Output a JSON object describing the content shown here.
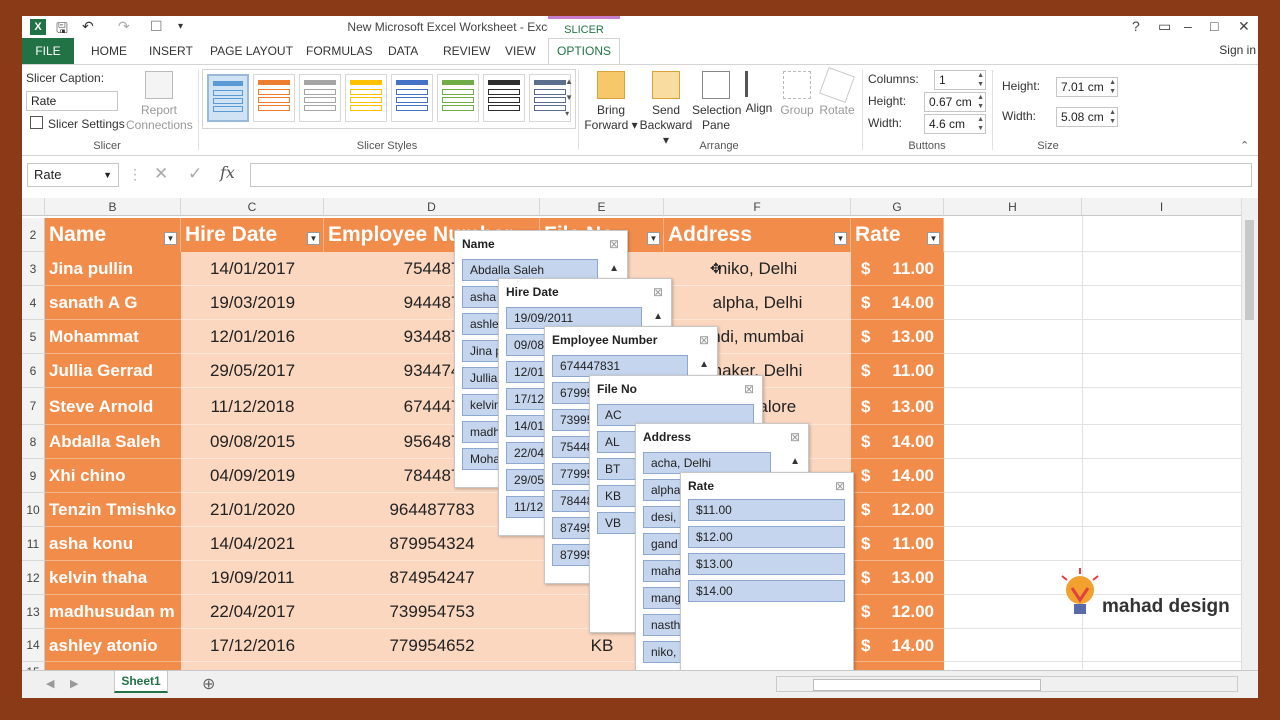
{
  "title_bar": {
    "title": "New Microsoft Excel Worksheet - Excel",
    "contextual_tab_group": "SLICER TOOLS",
    "help": "?",
    "window_controls": [
      "▭",
      "–",
      "□",
      "✕"
    ]
  },
  "ribbon_tabs": [
    "FILE",
    "HOME",
    "INSERT",
    "PAGE LAYOUT",
    "FORMULAS",
    "DATA",
    "REVIEW",
    "VIEW",
    "OPTIONS"
  ],
  "sign_in": "Sign in",
  "ribbon": {
    "slicer_group": {
      "caption_label": "Slicer Caption:",
      "caption_value": "Rate",
      "settings_label": "Slicer Settings",
      "report_connections_line1": "Report",
      "report_connections_line2": "Connections",
      "group_label": "Slicer"
    },
    "styles_group_label": "Slicer Styles",
    "style_colors": [
      "#5b9bd5",
      "#ed7d31",
      "#a5a5a5",
      "#ffc000",
      "#4472c4",
      "#70ad47",
      "#2e2e2e",
      "#5b6e8e"
    ],
    "arrange_group": {
      "bring_forward_1": "Bring",
      "bring_forward_2": "Forward ▾",
      "send_backward_1": "Send",
      "send_backward_2": "Backward ▾",
      "selection_pane_1": "Selection",
      "selection_pane_2": "Pane",
      "align": "Align",
      "group": "Group",
      "rotate": "Rotate",
      "group_label": "Arrange"
    },
    "buttons_group": {
      "columns_label": "Columns:",
      "columns_value": "1",
      "height_label": "Height:",
      "height_value": "0.67 cm",
      "width_label": "Width:",
      "width_value": "4.6 cm",
      "group_label": "Buttons"
    },
    "size_group": {
      "height_label": "Height:",
      "height_value": "7.01 cm",
      "width_label": "Width:",
      "width_value": "5.08 cm",
      "group_label": "Size"
    }
  },
  "formula_bar": {
    "name_box": "Rate",
    "fx": "fx",
    "formula": ""
  },
  "columns": [
    "B",
    "C",
    "D",
    "E",
    "F",
    "G",
    "H",
    "I"
  ],
  "rows": [
    "2",
    "3",
    "4",
    "5",
    "6",
    "7",
    "8",
    "9",
    "10",
    "11",
    "12",
    "13",
    "14",
    "15"
  ],
  "table": {
    "headers": [
      "Name",
      "Hire Date",
      "Employee Number",
      "File No",
      "Address",
      "Rate"
    ],
    "names": [
      "Jina pullin",
      "sanath A G",
      "Mohammat",
      "Jullia Gerrad",
      "Steve Arnold",
      "Abdalla Saleh",
      "Xhi chino",
      "Tenzin Tmishko",
      "asha konu",
      "kelvin thaha",
      "madhusudan m",
      "ashley atonio"
    ],
    "hire_dates": [
      "14/01/2017",
      "19/03/2019",
      "12/01/2016",
      "29/05/2017",
      "11/12/2018",
      "09/08/2015",
      "04/09/2019",
      "21/01/2020",
      "14/04/2021",
      "19/09/2011",
      "22/04/2017",
      "17/12/2016"
    ],
    "employee_numbers": [
      "754487",
      "944487",
      "934487",
      "934474",
      "674447",
      "956487",
      "784487",
      "964487783",
      "879954324",
      "874954247",
      "739954753",
      "779954652"
    ],
    "file_nos": [
      "",
      "",
      "",
      "",
      "",
      "",
      "",
      "",
      "",
      "",
      "",
      "KB"
    ],
    "addresses": [
      "niko, Delhi",
      "alpha, Delhi",
      "ndi, mumbai",
      "haker, Delhi",
      "Bangalore",
      "e",
      "",
      "",
      "",
      "",
      "",
      ""
    ],
    "rates": [
      "11.00",
      "14.00",
      "13.00",
      "11.00",
      "13.00",
      "14.00",
      "14.00",
      "12.00",
      "11.00",
      "13.00",
      "12.00",
      "14.00"
    ],
    "currency": "$"
  },
  "slicers": {
    "name": {
      "title": "Name",
      "items": [
        "Abdalla Saleh",
        "asha",
        "ashle",
        "Jina p",
        "Jullia",
        "kelvin",
        "madh",
        "Moha"
      ]
    },
    "hire_date": {
      "title": "Hire Date",
      "items": [
        "19/09/2011",
        "09/08",
        "12/01",
        "17/12",
        "14/01",
        "22/04",
        "29/05",
        "11/12"
      ]
    },
    "employee_number": {
      "title": "Employee Number",
      "items": [
        "674447831",
        "67995",
        "73995",
        "75448",
        "77995",
        "78448",
        "87495",
        "87995"
      ]
    },
    "file_no": {
      "title": "File No",
      "items": [
        "AC",
        "AL",
        "BT",
        "KB",
        "VB"
      ]
    },
    "address": {
      "title": "Address",
      "items": [
        "acha, Delhi",
        "alpha",
        "desi,",
        "gand",
        "maha",
        "mang",
        "nasth",
        "niko,"
      ]
    },
    "rate": {
      "title": "Rate",
      "items": [
        "$11.00",
        "$12.00",
        "$13.00",
        "$14.00"
      ]
    }
  },
  "sheet_tabs": [
    "Sheet1"
  ],
  "logo_text": "mahad design"
}
